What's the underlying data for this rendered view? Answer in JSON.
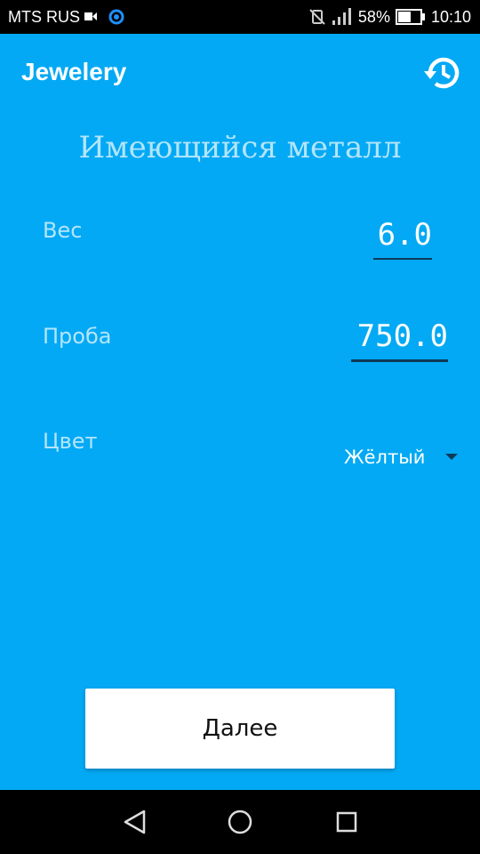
{
  "status_bar": {
    "carrier": "MTS RUS",
    "battery": "58%",
    "time": "10:10"
  },
  "app_bar": {
    "title": "Jewelery",
    "history_icon": "history-icon"
  },
  "form": {
    "heading": "Имеющийся металл",
    "weight": {
      "label": "Вес",
      "value": "6.0"
    },
    "assay": {
      "label": "Проба",
      "value": "750.0"
    },
    "color": {
      "label": "Цвет",
      "selected": "Жёлтый"
    }
  },
  "next_button": {
    "label": "Далее"
  },
  "nav_bar": {
    "icons": [
      "back-icon",
      "home-icon",
      "recents-icon"
    ]
  },
  "colors": {
    "background": "#03a9f4",
    "label_text": "#b3e5fc",
    "underline": "#0d3a58"
  }
}
